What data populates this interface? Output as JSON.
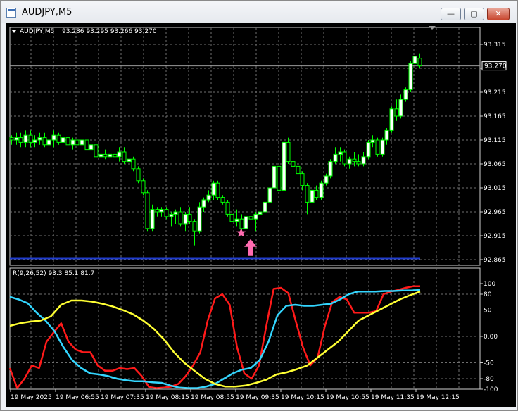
{
  "window": {
    "title": "AUDJPY,M5",
    "controls": {
      "minimize": "—",
      "maximize": "▢",
      "close": "✕"
    }
  },
  "chart_data": [
    {
      "type": "candlestick",
      "title": "AUDJPY,M5",
      "ohlc_header": "93.286 93.295 93.266 93.270",
      "current_price_label": "93.270",
      "current_price": 93.27,
      "y_ticks": [
        "93.315",
        "93.265",
        "93.215",
        "93.165",
        "93.115",
        "93.065",
        "93.015",
        "92.965",
        "92.915",
        "92.865"
      ],
      "ylim": [
        92.865,
        93.315
      ],
      "grid": true,
      "colors": {
        "background": "#000000",
        "bull": "#ffffff",
        "bear": "#000000",
        "wick": "#00ff00",
        "grid": "#6f6f6f",
        "support_line": "#1f3ccf",
        "signal": "#ff6bb0"
      },
      "support_line_price": 92.868,
      "signals": [
        {
          "type": "star",
          "bar": 49,
          "price": 92.921
        },
        {
          "type": "up-arrow",
          "bar": 51,
          "price": 92.905
        }
      ],
      "candles": [
        [
          93.12,
          93.125,
          93.105,
          93.115
        ],
        [
          93.115,
          93.13,
          93.105,
          93.12
        ],
        [
          93.12,
          93.13,
          93.1,
          93.11
        ],
        [
          93.11,
          93.135,
          93.1,
          93.125
        ],
        [
          93.125,
          93.135,
          93.1,
          93.11
        ],
        [
          93.11,
          93.125,
          93.1,
          93.115
        ],
        [
          93.115,
          93.13,
          93.105,
          93.12
        ],
        [
          93.12,
          93.13,
          93.1,
          93.105
        ],
        [
          93.105,
          93.12,
          93.095,
          93.115
        ],
        [
          93.115,
          93.135,
          93.1,
          93.125
        ],
        [
          93.125,
          93.13,
          93.105,
          93.11
        ],
        [
          93.11,
          93.125,
          93.1,
          93.12
        ],
        [
          93.12,
          93.13,
          93.1,
          93.105
        ],
        [
          93.105,
          93.12,
          93.095,
          93.115
        ],
        [
          93.115,
          93.125,
          93.1,
          93.105
        ],
        [
          93.105,
          93.12,
          93.095,
          93.115
        ],
        [
          93.115,
          93.12,
          93.09,
          93.095
        ],
        [
          93.095,
          93.11,
          93.09,
          93.105
        ],
        [
          93.105,
          93.12,
          93.075,
          93.08
        ],
        [
          93.08,
          93.09,
          93.07,
          93.085
        ],
        [
          93.085,
          93.095,
          93.075,
          93.08
        ],
        [
          93.08,
          93.09,
          93.075,
          93.085
        ],
        [
          93.085,
          93.095,
          93.075,
          93.08
        ],
        [
          93.08,
          93.1,
          93.07,
          93.09
        ],
        [
          93.09,
          93.1,
          93.065,
          93.07
        ],
        [
          93.07,
          93.08,
          93.06,
          93.075
        ],
        [
          93.075,
          93.08,
          93.05,
          93.055
        ],
        [
          93.055,
          93.06,
          93.025,
          93.03
        ],
        [
          93.03,
          93.035,
          93.0,
          93.005
        ],
        [
          93.005,
          93.01,
          92.925,
          92.93
        ],
        [
          92.93,
          92.98,
          92.925,
          92.97
        ],
        [
          92.97,
          92.975,
          92.955,
          92.965
        ],
        [
          92.965,
          92.975,
          92.955,
          92.97
        ],
        [
          92.97,
          92.975,
          92.95,
          92.955
        ],
        [
          92.955,
          92.965,
          92.935,
          92.96
        ],
        [
          92.96,
          92.97,
          92.94,
          92.965
        ],
        [
          92.965,
          92.975,
          92.935,
          92.94
        ],
        [
          92.94,
          92.965,
          92.925,
          92.96
        ],
        [
          92.96,
          92.975,
          92.94,
          92.945
        ],
        [
          92.945,
          92.95,
          92.895,
          92.925
        ],
        [
          92.925,
          92.985,
          92.92,
          92.975
        ],
        [
          92.975,
          92.995,
          92.965,
          92.99
        ],
        [
          92.99,
          93.01,
          92.985,
          93.0
        ],
        [
          93.0,
          93.03,
          92.99,
          93.025
        ],
        [
          93.025,
          93.03,
          92.99,
          92.995
        ],
        [
          92.995,
          93.0,
          92.98,
          92.985
        ],
        [
          92.985,
          92.99,
          92.955,
          92.96
        ],
        [
          92.96,
          92.965,
          92.935,
          92.945
        ],
        [
          92.945,
          92.97,
          92.935,
          92.95
        ],
        [
          92.95,
          92.96,
          92.925,
          92.93
        ],
        [
          92.93,
          92.965,
          92.925,
          92.955
        ],
        [
          92.955,
          92.96,
          92.94,
          92.95
        ],
        [
          92.95,
          92.965,
          92.925,
          92.96
        ],
        [
          92.96,
          92.975,
          92.955,
          92.965
        ],
        [
          92.965,
          92.99,
          92.96,
          92.985
        ],
        [
          92.985,
          93.025,
          92.98,
          93.015
        ],
        [
          93.015,
          93.07,
          93.01,
          93.06
        ],
        [
          93.06,
          93.08,
          93.0,
          93.01
        ],
        [
          93.01,
          93.125,
          93.005,
          93.11
        ],
        [
          93.11,
          93.12,
          93.065,
          93.07
        ],
        [
          93.07,
          93.075,
          93.055,
          93.06
        ],
        [
          93.06,
          93.065,
          93.035,
          93.045
        ],
        [
          93.045,
          93.05,
          93.01,
          93.02
        ],
        [
          93.02,
          93.025,
          92.96,
          92.985
        ],
        [
          92.985,
          93.02,
          92.975,
          93.01
        ],
        [
          93.01,
          93.02,
          92.99,
          92.995
        ],
        [
          92.995,
          93.03,
          92.99,
          93.025
        ],
        [
          93.025,
          93.045,
          93.02,
          93.04
        ],
        [
          93.04,
          93.075,
          93.035,
          93.07
        ],
        [
          93.07,
          93.1,
          93.065,
          93.085
        ],
        [
          93.085,
          93.1,
          93.07,
          93.09
        ],
        [
          93.09,
          93.095,
          93.06,
          93.065
        ],
        [
          93.065,
          93.08,
          93.055,
          93.075
        ],
        [
          93.075,
          93.09,
          93.06,
          93.07
        ],
        [
          93.07,
          93.085,
          93.06,
          93.065
        ],
        [
          93.065,
          93.09,
          93.06,
          93.08
        ],
        [
          93.08,
          93.115,
          93.075,
          93.11
        ],
        [
          93.11,
          93.125,
          93.1,
          93.115
        ],
        [
          93.115,
          93.12,
          93.08,
          93.085
        ],
        [
          93.085,
          93.12,
          93.08,
          93.115
        ],
        [
          93.115,
          93.14,
          93.105,
          93.135
        ],
        [
          93.135,
          93.185,
          93.13,
          93.18
        ],
        [
          93.18,
          93.2,
          93.155,
          93.165
        ],
        [
          93.165,
          93.21,
          93.16,
          93.2
        ],
        [
          93.2,
          93.225,
          93.195,
          93.22
        ],
        [
          93.22,
          93.28,
          93.215,
          93.275
        ],
        [
          93.275,
          93.3,
          93.28,
          93.29
        ],
        [
          93.286,
          93.295,
          93.266,
          93.27
        ]
      ]
    },
    {
      "type": "line",
      "title": "R(9,26,52) 93.3 85.1 81.7",
      "y_ticks": [
        "100",
        "80",
        "50",
        "0.00",
        "-50",
        "-80",
        "-100"
      ],
      "ylim": [
        -100,
        100
      ],
      "grid": true,
      "series": [
        {
          "color": "#ff1a1a",
          "values": [
            -60,
            -98,
            -80,
            -55,
            -60,
            -10,
            8,
            25,
            -10,
            -25,
            -30,
            -30,
            -55,
            -65,
            -65,
            -60,
            -62,
            -60,
            -75,
            -96,
            -98,
            -97,
            -95,
            -90,
            -75,
            -55,
            -30,
            30,
            72,
            80,
            60,
            -20,
            -70,
            -80,
            -55,
            20,
            90,
            92,
            82,
            30,
            -20,
            -55,
            -40,
            20,
            65,
            75,
            70,
            45,
            45,
            45,
            48,
            80,
            85,
            88,
            92,
            95,
            95
          ]
        },
        {
          "color": "#33d6ff",
          "values": [
            75,
            70,
            63,
            45,
            30,
            10,
            -20,
            -45,
            -60,
            -70,
            -72,
            -75,
            -80,
            -83,
            -85,
            -85,
            -87,
            -88,
            -93,
            -97,
            -98,
            -98,
            -95,
            -90,
            -80,
            -70,
            -63,
            -60,
            -45,
            -10,
            40,
            58,
            60,
            58,
            58,
            60,
            62,
            70,
            80,
            85,
            85,
            85,
            86,
            86,
            87,
            87,
            88
          ]
        },
        {
          "color": "#ffff33",
          "values": [
            20,
            25,
            28,
            30,
            38,
            60,
            68,
            68,
            66,
            62,
            57,
            50,
            42,
            30,
            15,
            -5,
            -30,
            -50,
            -65,
            -80,
            -90,
            -95,
            -95,
            -93,
            -88,
            -82,
            -72,
            -68,
            -62,
            -55,
            -40,
            -25,
            -10,
            10,
            30,
            40,
            50,
            60,
            70,
            78,
            85
          ]
        }
      ]
    }
  ],
  "x_axis_labels": [
    "19 May 2025",
    "19 May 06:55",
    "19 May 07:35",
    "19 May 08:15",
    "19 May 08:55",
    "19 May 09:35",
    "19 May 10:15",
    "19 May 10:55",
    "19 May 11:35",
    "19 May 12:15"
  ]
}
